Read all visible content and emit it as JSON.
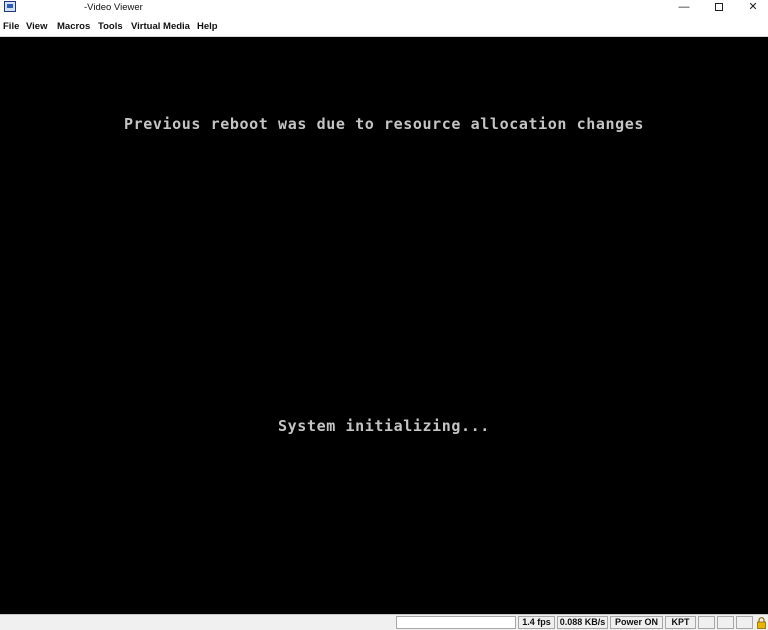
{
  "window": {
    "title": "-Video Viewer",
    "min_glyph": "—",
    "close_glyph": "✕"
  },
  "menu": {
    "items": [
      "File",
      "View",
      "Macros",
      "Tools",
      "Virtual Media",
      "Help"
    ]
  },
  "console": {
    "line1": "Previous reboot was due to resource allocation changes",
    "line2": "System initializing..."
  },
  "status": {
    "fps": "1.4 fps",
    "rate": "0.088 KB/s",
    "power": "Power ON",
    "keyboard": "KPT"
  },
  "colors": {
    "console_bg": "#000000",
    "console_text": "#c4c4c4",
    "lock": "#e8b400"
  }
}
